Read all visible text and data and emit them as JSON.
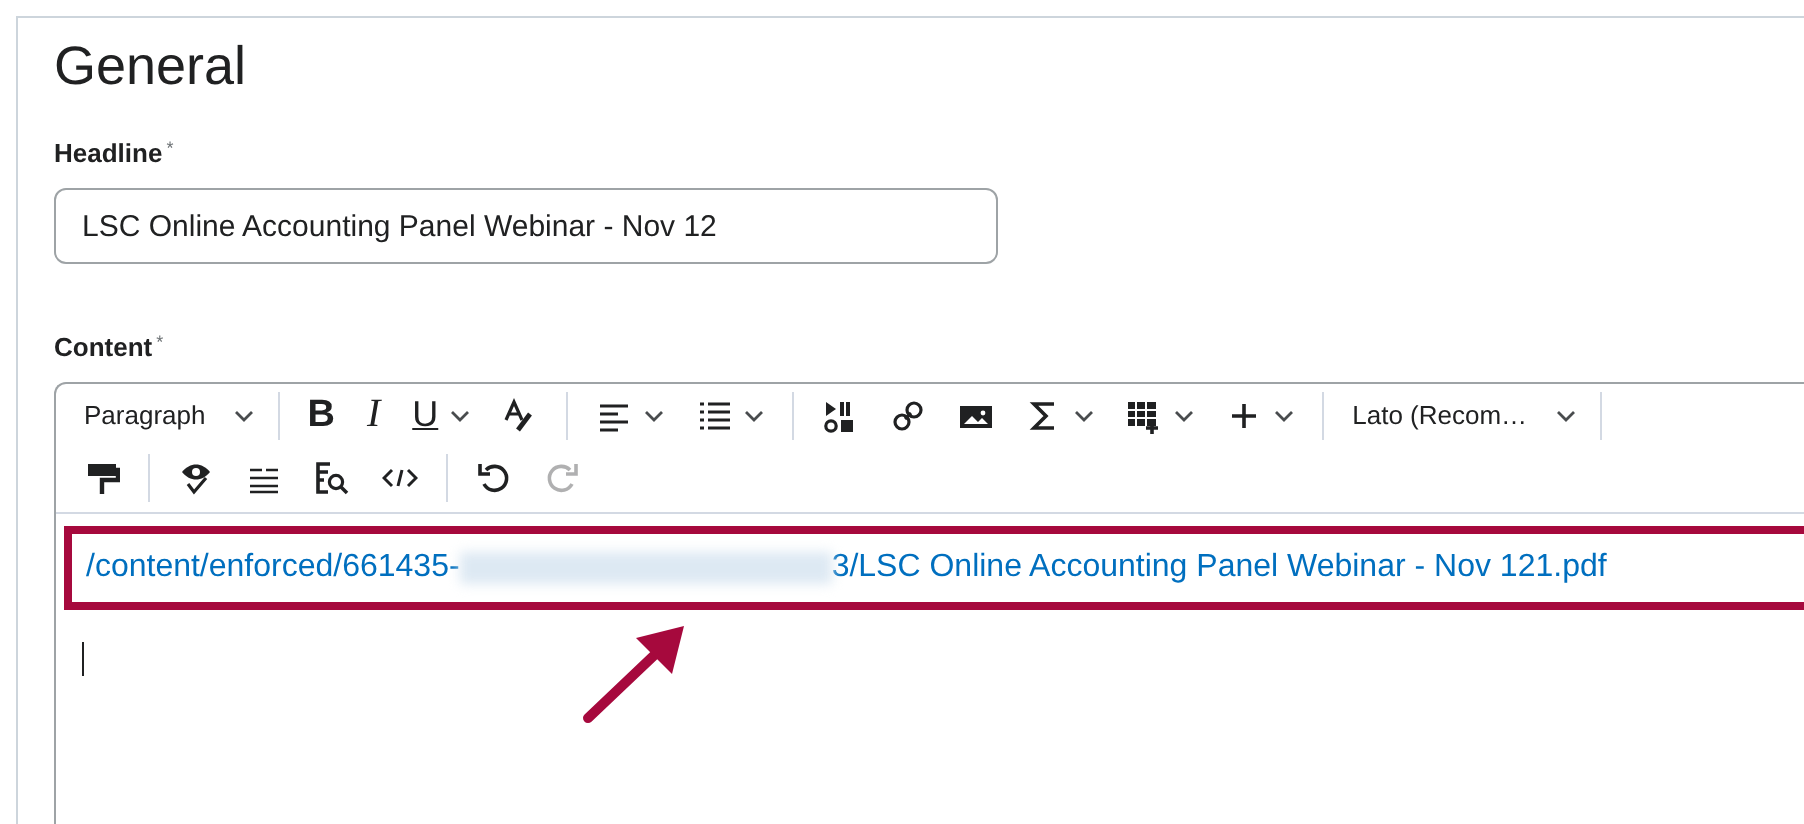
{
  "section_title": "General",
  "headline": {
    "label": "Headline",
    "required_mark": "*",
    "value": "LSC Online Accounting Panel Webinar - Nov 12"
  },
  "content": {
    "label": "Content",
    "required_mark": "*",
    "toolbar": {
      "block_format": "Paragraph",
      "format_buttons": [
        "B",
        "I",
        "U"
      ],
      "font": "Lato (Recom…",
      "undo": {
        "disabled": false
      },
      "redo": {
        "disabled": true
      }
    },
    "link_start": "/content/enforced/661435-",
    "link_end": "3/LSC Online Accounting Panel Webinar - Nov 121.pdf",
    "redacted": true,
    "highlighted": true
  }
}
